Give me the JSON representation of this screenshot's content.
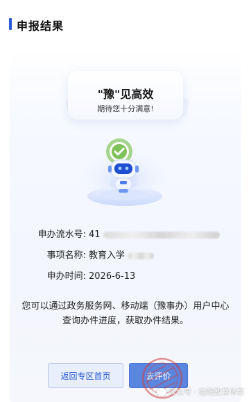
{
  "header": {
    "title": "申报结果"
  },
  "result": {
    "slogan": "\"豫\"见高效",
    "slogan_sub": "期待您十分满意!"
  },
  "fields": [
    {
      "label": "申办流水号:",
      "value": "41"
    },
    {
      "label": "事项名称:",
      "value": "教育入学"
    },
    {
      "label": "申办时间:",
      "value": "2026-6-13"
    }
  ],
  "notice": "您可以通过政务服务网、移动端（豫事办）用户中心查询办件进度，获取办件结果。",
  "buttons": {
    "back": "返回专区首页",
    "evaluate": "去评价"
  },
  "watermark": "公众号 · 信阳教育体育",
  "colors": {
    "accent": "#2a5bd7",
    "button_primary": "#5b86e0",
    "stamp": "#d23a3a"
  }
}
